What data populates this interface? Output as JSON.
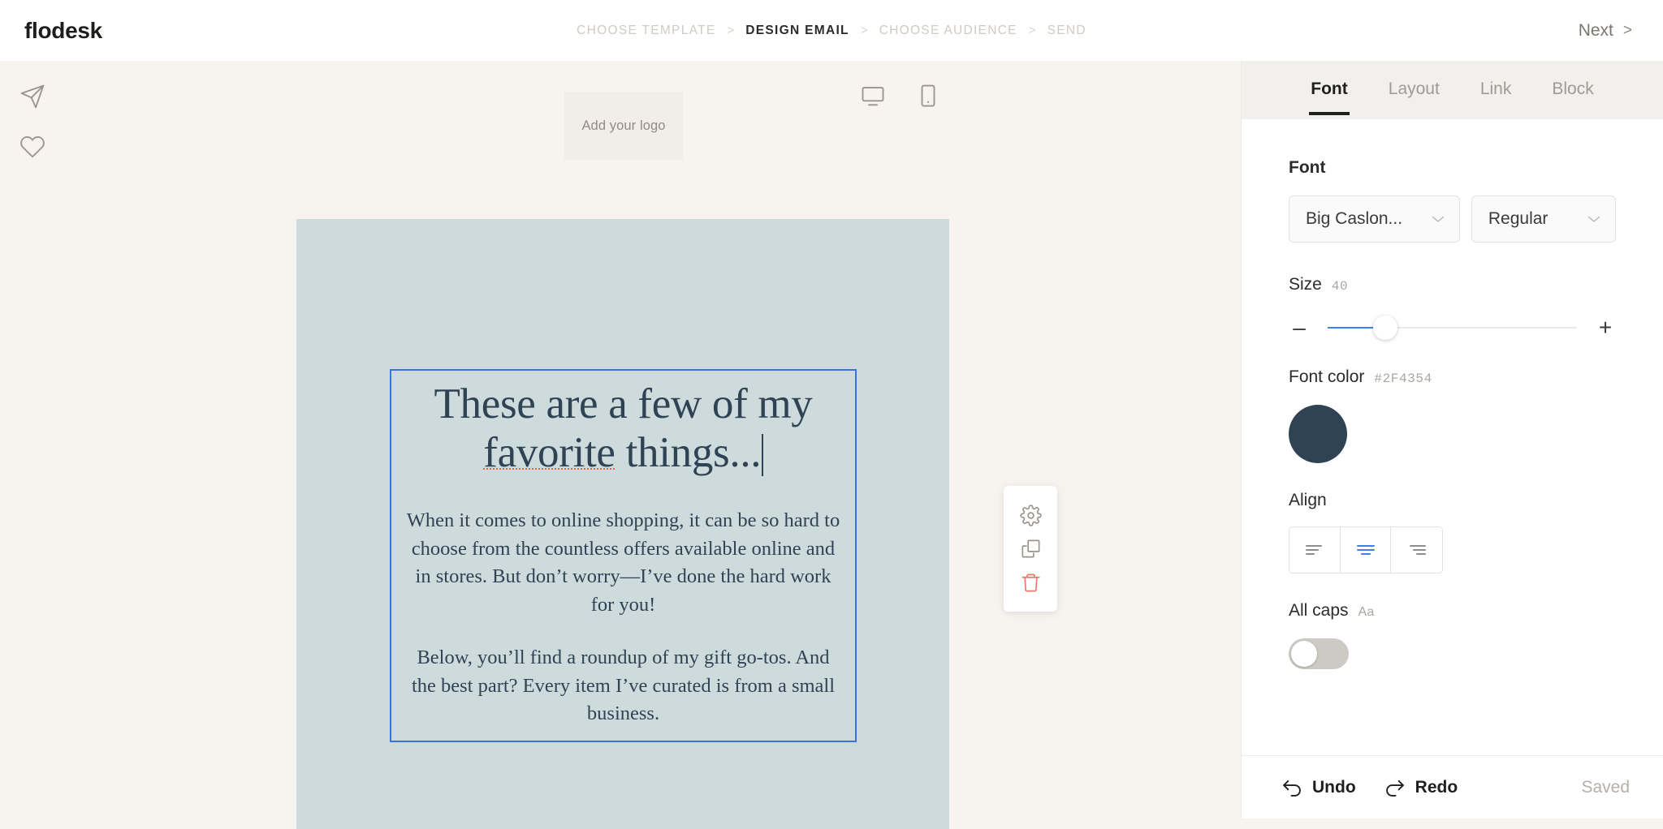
{
  "topbar": {
    "brand": "flodesk",
    "steps": [
      {
        "label": "CHOOSE TEMPLATE",
        "active": false
      },
      {
        "label": "DESIGN EMAIL",
        "active": true
      },
      {
        "label": "CHOOSE AUDIENCE",
        "active": false
      },
      {
        "label": "SEND",
        "active": false
      }
    ],
    "separator": ">",
    "next_label": "Next",
    "next_chevron": ">"
  },
  "canvas": {
    "left_tools": [
      {
        "name": "send-icon",
        "title": "Send test"
      },
      {
        "name": "heart-icon",
        "title": "Favorite"
      }
    ],
    "device_toggles": [
      {
        "name": "desktop-preview-icon",
        "title": "Desktop"
      },
      {
        "name": "mobile-preview-icon",
        "title": "Mobile"
      }
    ],
    "logo_placeholder": "Add your logo",
    "email_block_bg": "#CEDBDC",
    "selection_color": "#3D71E0",
    "heading": "These are a few of my favorite things...",
    "heading_line1": "These are a few of my",
    "heading_line2_pre": "favo",
    "heading_line2_spell": "favorite",
    "heading_line2_post": " things...",
    "paragraphs": [
      "When it comes to online shopping, it can be so hard to choose from the countless offers available online and in stores. But don’t worry—I’ve done the hard work for you!",
      "Below, you’ll find a roundup of my gift go-tos. And the best part? Every item I’ve curated is from a small business."
    ],
    "block_toolbar": [
      {
        "name": "gear-icon",
        "label": "Settings"
      },
      {
        "name": "duplicate-icon",
        "label": "Duplicate"
      },
      {
        "name": "trash-icon",
        "label": "Delete"
      }
    ]
  },
  "panel": {
    "tabs": [
      {
        "label": "Font",
        "active": true
      },
      {
        "label": "Layout",
        "active": false
      },
      {
        "label": "Link",
        "active": false
      },
      {
        "label": "Block",
        "active": false
      }
    ],
    "font": {
      "label": "Font",
      "family_value": "Big Caslon...",
      "weight_value": "Regular"
    },
    "size": {
      "label": "Size",
      "value": "40",
      "minus": "–",
      "plus": "+",
      "percent": 23
    },
    "font_color": {
      "label": "Font color",
      "hex": "#2F4354"
    },
    "align": {
      "label": "Align",
      "options": [
        "left",
        "center",
        "right"
      ],
      "selected": "center",
      "accent": "#3B7FF5"
    },
    "all_caps": {
      "label": "All caps",
      "hint": "Aa",
      "enabled": false
    },
    "footer": {
      "undo": "Undo",
      "redo": "Redo",
      "status": "Saved"
    }
  }
}
